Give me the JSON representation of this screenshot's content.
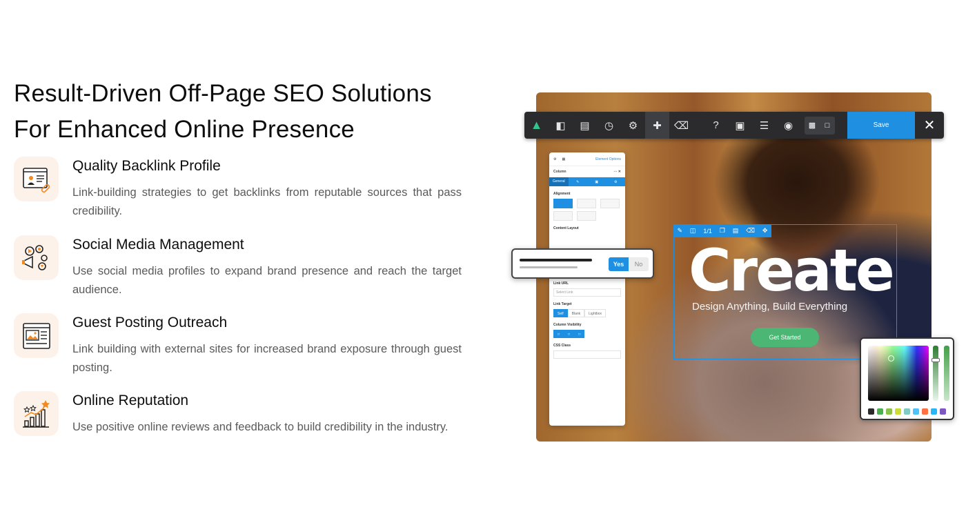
{
  "headline": {
    "line1": "Result-Driven Off-Page SEO Solutions",
    "line2": "For Enhanced Online Presence"
  },
  "features": [
    {
      "icon": "backlink-profile-icon",
      "title": "Quality Backlink Profile",
      "desc": "Link-building strategies to get backlinks from reputable sources that pass credibility."
    },
    {
      "icon": "social-media-icon",
      "title": "Social Media Management",
      "desc": "Use social media profiles to expand brand presence and reach the target audience."
    },
    {
      "icon": "guest-posting-icon",
      "title": "Guest Posting Outreach",
      "desc": "Link building with external sites for increased brand exposure through guest posting."
    },
    {
      "icon": "online-reputation-icon",
      "title": "Online Reputation",
      "desc": "Use positive online reviews and feedback to build credibility in the industry."
    }
  ],
  "mockup": {
    "toolbar": {
      "save_label": "Save"
    },
    "panel": {
      "tab_link": "Element Options",
      "title": "Column",
      "tabs": [
        "General",
        "",
        "",
        ""
      ],
      "alignment_label": "Alignment",
      "content_layout_label": "Content Layout",
      "link_url_label": "Link URL",
      "link_url_placeholder": "Select Link",
      "link_target_label": "Link Target",
      "link_target_options": [
        "Self",
        "Blank",
        "Lightbox"
      ],
      "column_visibility_label": "Column Visibility",
      "css_class_label": "CSS Class"
    },
    "toggle": {
      "yes": "Yes",
      "no": "No"
    },
    "selection": {
      "counter": "1/1"
    },
    "hero": {
      "title": "Create",
      "subtitle": "Design Anything, Build Everything",
      "button": "Get Started"
    },
    "swatch_colors": [
      "#2b2b2b",
      "#4caf50",
      "#8bc34a",
      "#cddc39",
      "#80cbc4",
      "#4fc3f7",
      "#ff7043",
      "#29b6f6",
      "#7e57c2"
    ]
  }
}
